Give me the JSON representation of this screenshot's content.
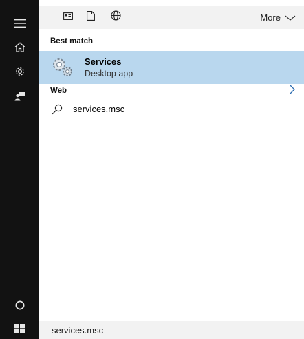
{
  "filters": {
    "more_label": "More"
  },
  "icons": {
    "hamburger": "hamburger-menu-icon",
    "home": "home-icon",
    "settings": "gear-icon",
    "feedback": "feedback-user-icon",
    "cortana": "cortana-circle-icon",
    "start": "windows-start-icon",
    "apps_filter": "apps-filter-icon",
    "documents_filter": "document-icon",
    "web_filter": "globe-icon",
    "more_chevron": "chevron-down-icon",
    "services_app": "services-gear-icon",
    "web_search": "search-icon",
    "web_arrow": "chevron-right-icon"
  },
  "results": {
    "best_match_header": "Best match",
    "best_match": {
      "title": "Services",
      "subtitle": "Desktop app"
    },
    "web_header": "Web",
    "web_suggestion": "services.msc"
  },
  "search": {
    "value": "services.msc"
  },
  "colors": {
    "rail": "#121212",
    "selected": "#b9d7ee",
    "bar": "#f2f2f2"
  }
}
